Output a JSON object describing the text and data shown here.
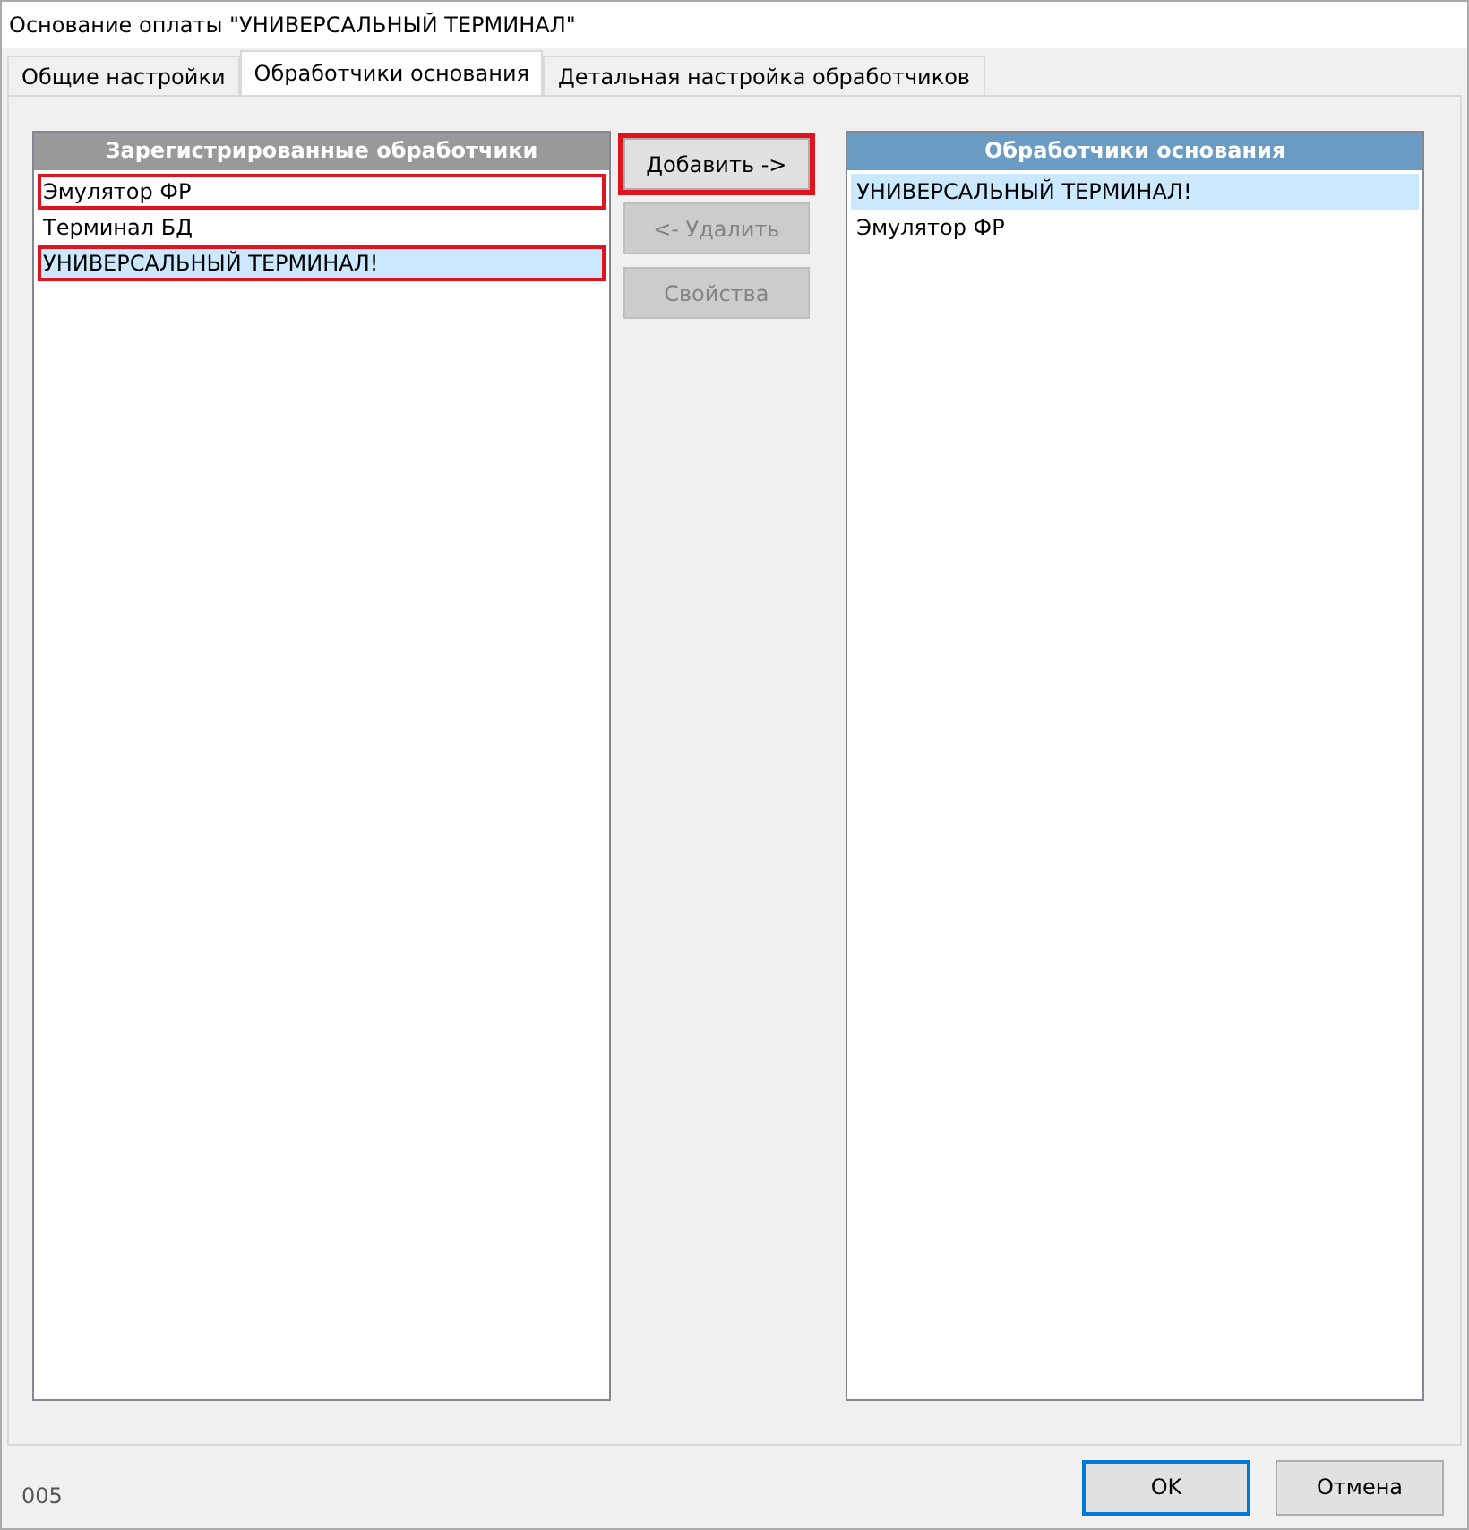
{
  "window": {
    "title": "Основание оплаты \"УНИВЕРСАЛЬНЫЙ ТЕРМИНАЛ\""
  },
  "tabs": [
    {
      "label": "Общие настройки",
      "selected": false
    },
    {
      "label": "Обработчики основания",
      "selected": true
    },
    {
      "label": "Детальная настройка обработчиков",
      "selected": false
    }
  ],
  "registered": {
    "title": "Зарегистрированные обработчики",
    "items": [
      {
        "label": "Эмулятор ФР",
        "selected": false,
        "highlighted": true
      },
      {
        "label": "Терминал БД",
        "selected": false,
        "highlighted": false
      },
      {
        "label": "УНИВЕРСАЛЬНЫЙ ТЕРМИНАЛ!",
        "selected": true,
        "highlighted": true
      }
    ]
  },
  "actions": [
    {
      "label": "Добавить ->",
      "disabled": false,
      "highlighted": true
    },
    {
      "label": "<- Удалить",
      "disabled": true,
      "highlighted": false
    },
    {
      "label": "Свойства",
      "disabled": true,
      "highlighted": false
    }
  ],
  "assigned": {
    "title": "Обработчики основания",
    "items": [
      {
        "label": "УНИВЕРСАЛЬНЫЙ ТЕРМИНАЛ!",
        "selected": true,
        "highlighted": false
      },
      {
        "label": "Эмулятор ФР",
        "selected": false,
        "highlighted": false
      }
    ]
  },
  "status_code": "005",
  "buttons": [
    {
      "label": "OK",
      "default": true
    },
    {
      "label": "Отмена",
      "default": false
    }
  ]
}
